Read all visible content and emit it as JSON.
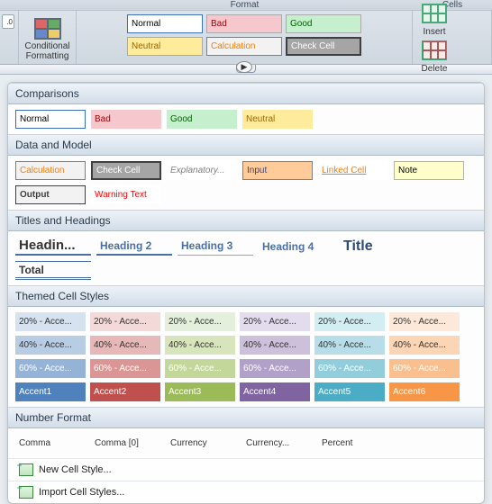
{
  "ribbon": {
    "group_format": "Format",
    "group_cells": "Cells",
    "numfmt_stub": ".0",
    "conditional_formatting": "Conditional\nFormatting",
    "gallery": {
      "normal": "Normal",
      "bad": "Bad",
      "good": "Good",
      "neutral": "Neutral",
      "calculation": "Calculation",
      "check_cell": "Check Cell"
    },
    "insert": "Insert",
    "delete": "Delete"
  },
  "panel": {
    "comparisons": {
      "title": "Comparisons",
      "items": [
        {
          "label": "Normal",
          "bg": "#ffffff",
          "fg": "#000",
          "border": "1px solid #3b6fb6"
        },
        {
          "label": "Bad",
          "bg": "#f6c8ce",
          "fg": "#9c0006"
        },
        {
          "label": "Good",
          "bg": "#c6efce",
          "fg": "#006100"
        },
        {
          "label": "Neutral",
          "bg": "#ffeb9c",
          "fg": "#9c6500"
        }
      ]
    },
    "data_model": {
      "title": "Data and Model",
      "items": [
        {
          "label": "Calculation",
          "bg": "#f2f2f2",
          "fg": "#fa7d00",
          "border": "1px solid #7f7f7f"
        },
        {
          "label": "Check Cell",
          "bg": "#a5a5a5",
          "fg": "#ffffff",
          "border": "2px double #3f3f3f"
        },
        {
          "label": "Explanatory...",
          "bg": "#ffffff",
          "fg": "#808080",
          "style": "italic"
        },
        {
          "label": "Input",
          "bg": "#ffcc99",
          "fg": "#3f3f76",
          "border": "1px solid #7f7f7f"
        },
        {
          "label": "Linked Cell",
          "bg": "#ffffff",
          "fg": "#fa7d00",
          "underline": true
        },
        {
          "label": "Note",
          "bg": "#ffffcc",
          "fg": "#000",
          "border": "1px solid #b2b2b2"
        },
        {
          "label": "Output",
          "bg": "#f2f2f2",
          "fg": "#3f3f3f",
          "border": "1px solid #3f3f3f",
          "bold": true
        },
        {
          "label": "Warning Text",
          "bg": "#ffffff",
          "fg": "#ff0000"
        }
      ]
    },
    "titles": {
      "title": "Titles and Headings",
      "items": [
        "Headin...",
        "Heading 2",
        "Heading 3",
        "Heading 4",
        "Title",
        "Total"
      ]
    },
    "themed": {
      "title": "Themed Cell Styles",
      "rows": [
        {
          "pct": "20%",
          "colors": [
            "#d6e2f0",
            "#f4d9d9",
            "#e4efdc",
            "#e3dced",
            "#d3eef3",
            "#fde9d9"
          ]
        },
        {
          "pct": "40%",
          "colors": [
            "#b8cce4",
            "#e6b8b8",
            "#d7e4bc",
            "#ccc0da",
            "#b7dee8",
            "#fcd5b4"
          ]
        },
        {
          "pct": "60%",
          "colors": [
            "#95b3d7",
            "#da9694",
            "#c4d79b",
            "#b1a0c7",
            "#92cddc",
            "#fabf8f"
          ],
          "fg": "#ffffff"
        },
        {
          "pct": "",
          "labels": [
            "Accent1",
            "Accent2",
            "Accent3",
            "Accent4",
            "Accent5",
            "Accent6"
          ],
          "colors": [
            "#4f81bd",
            "#c0504d",
            "#9bbb59",
            "#8064a2",
            "#4bacc6",
            "#f79646"
          ],
          "fg": "#ffffff"
        }
      ]
    },
    "number_format": {
      "title": "Number Format",
      "items": [
        "Comma",
        "Comma [0]",
        "Currency",
        "Currency...",
        "Percent"
      ]
    },
    "footer": {
      "new_style": "New Cell Style...",
      "import_styles": "Import Cell Styles..."
    }
  }
}
